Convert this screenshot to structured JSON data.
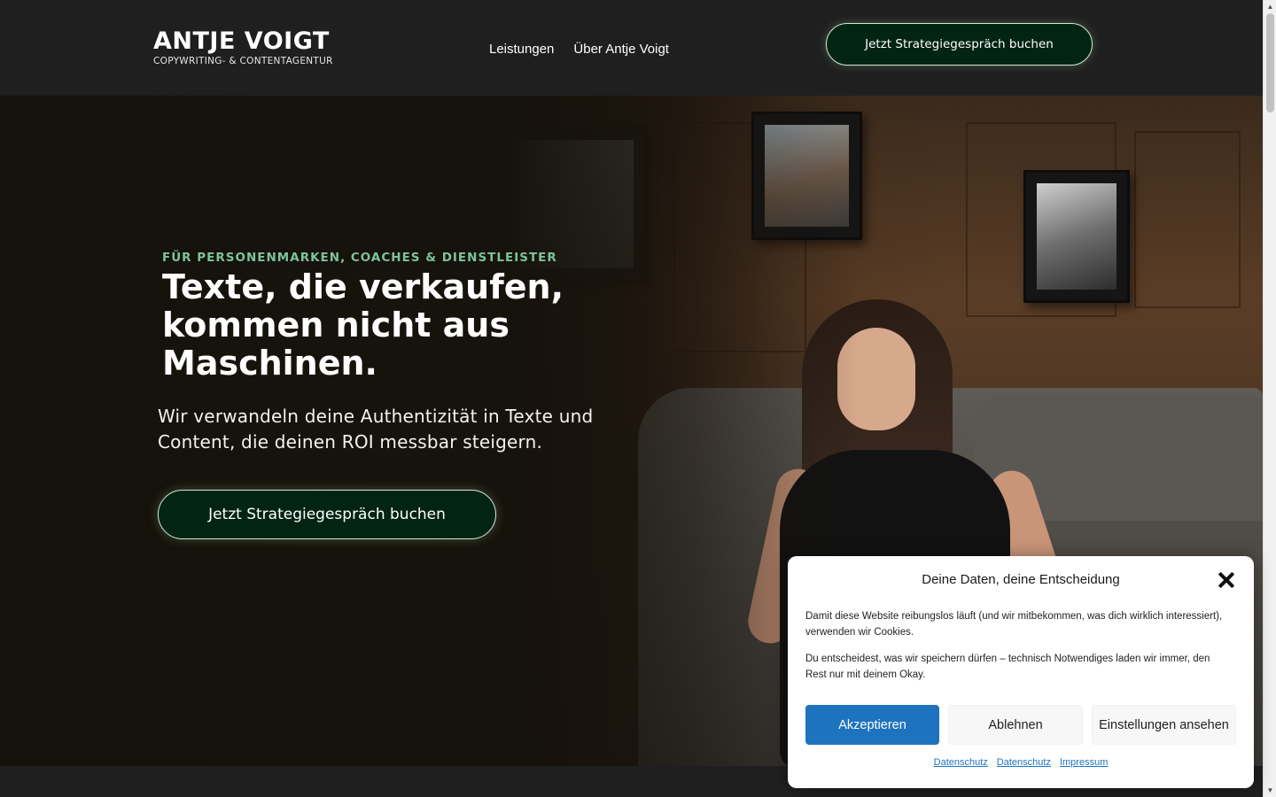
{
  "header": {
    "logo_main": "ANTJE VOIGT",
    "logo_sub": "COPYWRITING- & CONTENTAGENTUR",
    "nav": [
      {
        "label": "Leistungen"
      },
      {
        "label": "Über Antje Voigt"
      }
    ],
    "cta_label": "Jetzt Strategiegespräch buchen"
  },
  "hero": {
    "eyebrow": "FÜR PERSONENMARKEN, COACHES & DIENSTLEISTER",
    "headline": "Texte, die verkaufen, kommen nicht aus Maschinen.",
    "subline": "Wir verwandeln deine Authentizität in Texte und Content, die deinen ROI messbar steigern.",
    "cta_label": "Jetzt Strategiegespräch buchen"
  },
  "cookie": {
    "title": "Deine Daten, deine Entscheidung",
    "text1": "Damit diese Website reibungslos läuft (und wir mitbekommen, was dich wirklich interessiert), verwenden wir Cookies.",
    "text2": "Du entscheidest, was wir speichern dürfen – technisch Notwendiges laden wir immer, den Rest nur mit deinem Okay.",
    "accept_label": "Akzeptieren",
    "deny_label": "Ablehnen",
    "settings_label": "Einstellungen ansehen",
    "links": [
      {
        "label": "Datenschutz"
      },
      {
        "label": "Datenschutz"
      },
      {
        "label": "Impressum"
      }
    ]
  },
  "colors": {
    "accent_green": "#7cc49a",
    "cta_background": "#022412",
    "cookie_primary": "#1e73be"
  }
}
